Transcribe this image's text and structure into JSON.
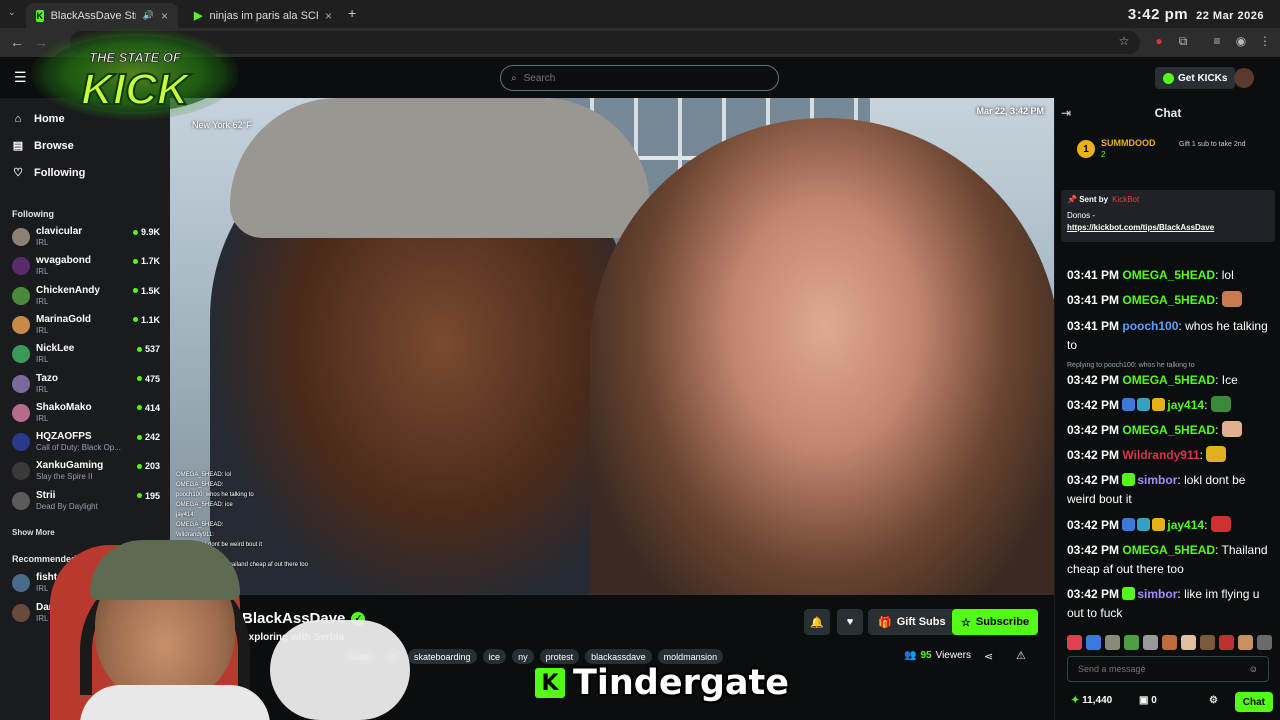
{
  "browser": {
    "tabs": [
      {
        "title": "BlackAssDave Stream - Wa",
        "active": true,
        "icon": "kick-favicon"
      },
      {
        "title": "ninjas im paris ala SCRABSNYC",
        "active": false,
        "icon": "play-favicon"
      }
    ],
    "clock_time": "3:42 pm",
    "clock_date": "22 Mar 2026",
    "new_tab": "+",
    "close": "×"
  },
  "header": {
    "search_placeholder": "Search",
    "get_kicks": "Get KICKs",
    "menu_icon": "hamburger-icon"
  },
  "logo": {
    "line1": "THE STATE OF",
    "line2": "KICK"
  },
  "sidebar": {
    "nav": [
      {
        "label": "Home",
        "icon": "home-icon"
      },
      {
        "label": "Browse",
        "icon": "browse-icon"
      },
      {
        "label": "Following",
        "icon": "heart-icon"
      }
    ],
    "following_header": "Following",
    "channels": [
      {
        "name": "clavicular",
        "category": "IRL",
        "viewers": "9.9K",
        "color": "#8b7f76"
      },
      {
        "name": "wvagabond",
        "category": "IRL",
        "viewers": "1.7K",
        "color": "#5a2a6a"
      },
      {
        "name": "ChickenAndy",
        "category": "IRL",
        "viewers": "1.5K",
        "color": "#4a8a3a"
      },
      {
        "name": "MarinaGold",
        "category": "IRL",
        "viewers": "1.1K",
        "color": "#c78a4a"
      },
      {
        "name": "NickLee",
        "category": "IRL",
        "viewers": "537",
        "color": "#3a9a5a"
      },
      {
        "name": "Tazo",
        "category": "IRL",
        "viewers": "475",
        "color": "#7a6a9a"
      },
      {
        "name": "ShakoMako",
        "category": "IRL",
        "viewers": "414",
        "color": "#b86a8a"
      },
      {
        "name": "HQZAOFPS",
        "category": "Call of Duty: Black Op...",
        "viewers": "242",
        "color": "#2a3a8a"
      },
      {
        "name": "XankuGaming",
        "category": "Slay the Spire II",
        "viewers": "203",
        "color": "#3a3a3a"
      },
      {
        "name": "Strii",
        "category": "Dead By Daylight",
        "viewers": "195",
        "color": "#5a5a5a"
      }
    ],
    "show_more": "Show More",
    "recommended_header": "Recommended",
    "recommended": [
      {
        "name": "fishtank",
        "category": "IRL",
        "color": "#4a6a8a"
      },
      {
        "name": "Dam",
        "category": "IRL",
        "color": "#6a4a3a"
      }
    ]
  },
  "video": {
    "timestamp": "Mar 22, 3:42 PM",
    "weather_city": "New York",
    "weather_temp": "62°F",
    "mini_chat": [
      "OMEGA_5HEAD: lol",
      "OMEGA_5HEAD:",
      "pooch100: whos he talking to",
      "OMEGA_5HEAD: ice",
      "jay414:",
      "OMEGA_5HEAD:",
      "Wildrandy911:",
      "simbor: lokl dont be weird bout it",
      "jay414:",
      "OMEGA_5HEAD: Thailand cheap af out there too"
    ]
  },
  "stream": {
    "streamer": "BlackAssDave",
    "title": "Exploring with Serbia",
    "tags": [
      "Skate",
      "irl",
      "skateboarding",
      "ice",
      "ny",
      "protest",
      "blackassdave",
      "moldmansion"
    ],
    "viewers": "95",
    "viewers_label": "Viewers",
    "gift_subs": "Gift Subs",
    "subscribe": "Subscribe"
  },
  "overlay_caption": "Tindergate",
  "chat": {
    "title": "Chat",
    "pinned": {
      "user": "SUMMDOOD",
      "count": "2",
      "rank": "1",
      "gift_text": "Gift 1 sub to take 2nd"
    },
    "kickbot": {
      "sent_by": "Sent by",
      "bot_name": "KickBot",
      "donos": "Donos -",
      "link": "https://kickbot.com/tips/BlackAssDave"
    },
    "messages": [
      {
        "time": "03:41 PM",
        "user": "OMEGA_5HEAD",
        "color": "#53fc18",
        "text": "lol"
      },
      {
        "time": "03:41 PM",
        "user": "OMEGA_5HEAD",
        "color": "#53fc18",
        "text": ""
      },
      {
        "time": "03:41 PM",
        "user": "pooch100",
        "color": "#5aa0ff",
        "text": "whos he talking to"
      },
      {
        "time": "03:42 PM",
        "user": "OMEGA_5HEAD",
        "color": "#53fc18",
        "text": "Ice"
      },
      {
        "time": "03:42 PM",
        "user": "jay414",
        "color": "#53fc18",
        "text": ""
      },
      {
        "time": "03:42 PM",
        "user": "OMEGA_5HEAD",
        "color": "#53fc18",
        "text": ""
      },
      {
        "time": "03:42 PM",
        "user": "Wildrandy911",
        "color": "#e0304a",
        "text": ""
      },
      {
        "time": "03:42 PM",
        "user": "simbor",
        "color": "#a88bff",
        "text": "lokl dont be weird bout it"
      },
      {
        "time": "03:42 PM",
        "user": "jay414",
        "color": "#53fc18",
        "text": ""
      },
      {
        "time": "03:42 PM",
        "user": "OMEGA_5HEAD",
        "color": "#53fc18",
        "text": "Thailand cheap af out there too"
      },
      {
        "time": "03:42 PM",
        "user": "simbor",
        "color": "#a88bff",
        "text": "like im flying u out to fuck"
      }
    ],
    "reply_note": "Replying to pooch100: whos he talking to",
    "input_placeholder": "Send a message",
    "kicks_balance": "11,440",
    "gift_count": "0",
    "chat_button": "Chat"
  },
  "colors": {
    "accent": "#53fc18",
    "bg": "#0b0e0f",
    "panel": "#191b1f"
  }
}
